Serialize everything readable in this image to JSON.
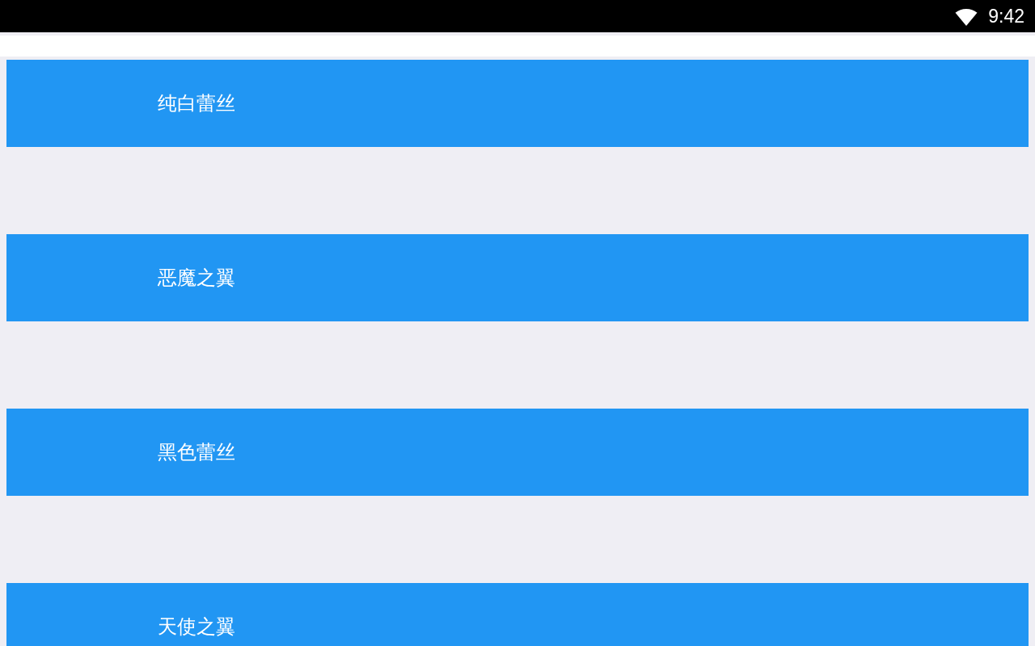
{
  "status_bar": {
    "time": "9:42"
  },
  "items": [
    {
      "label": "纯白蕾丝"
    },
    {
      "label": "恶魔之翼"
    },
    {
      "label": "黑色蕾丝"
    },
    {
      "label": "天使之翼"
    }
  ]
}
